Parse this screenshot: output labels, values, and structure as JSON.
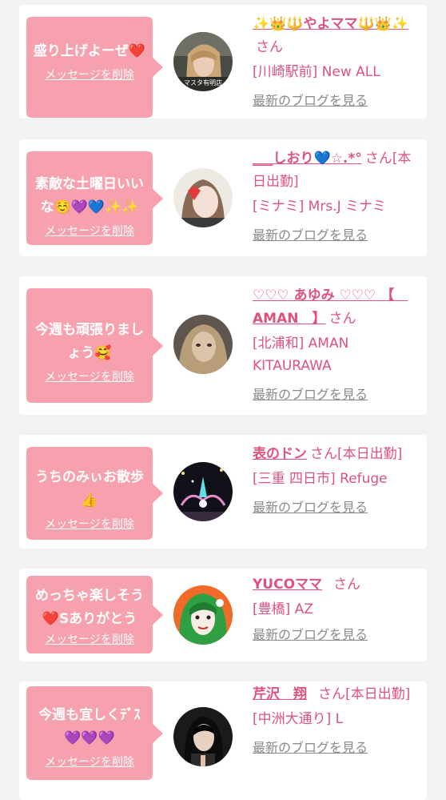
{
  "delete_label": "メッセージを削除",
  "blog_label": "最新のブログを見る",
  "san": "さん",
  "colors": {
    "background": "#f2f2f2",
    "card": "#ffffff",
    "bubble": "#f7a1ae",
    "name": "#e0527d",
    "blog_link": "#8a8a8a"
  },
  "items": [
    {
      "message": "盛り上げよーぜ❤️",
      "name": "✨👑🔱やよママ🔱👑✨",
      "badge": "",
      "shop": "[川崎駅前] New ALL",
      "avatar_text": "マスタ有明店",
      "avatar_icon": "blonde-woman-photo"
    },
    {
      "message": "素敵な土曜日いいな☺️💜💙✨✨",
      "name": "___しおり💙☆.*°",
      "badge": "[本日出勤]",
      "shop": "[ミナミ] Mrs.J ミナミ",
      "avatar_icon": "woman-heart-sticker-photo"
    },
    {
      "message": "今週も頑張りましょう🥰",
      "name": "♡♡♡ あゆみ ♡♡♡ 【　AMAN　】",
      "badge": "",
      "shop": "[北浦和] AMAN KITAURAWA",
      "avatar_icon": "blurred-woman-photo"
    },
    {
      "message": "うちのみぃお散歩👍",
      "name": "表のドン",
      "badge": "[本日出勤]",
      "shop": "[三重 四日市] Refuge",
      "avatar_icon": "night-illumination-photo"
    },
    {
      "message": "めっちゃ楽しそう❤️Sありがとう",
      "name": "YUCOママ",
      "badge": "",
      "shop": "[豊橋] AZ",
      "avatar_icon": "green-hair-illustration"
    },
    {
      "message": "今週も宜しくﾃﾞｽ💜💜💜",
      "name": "芹沢　翔",
      "badge": "[本日出勤]",
      "shop": "[中洲大通り] L",
      "avatar_icon": "dark-hair-man-photo"
    }
  ]
}
